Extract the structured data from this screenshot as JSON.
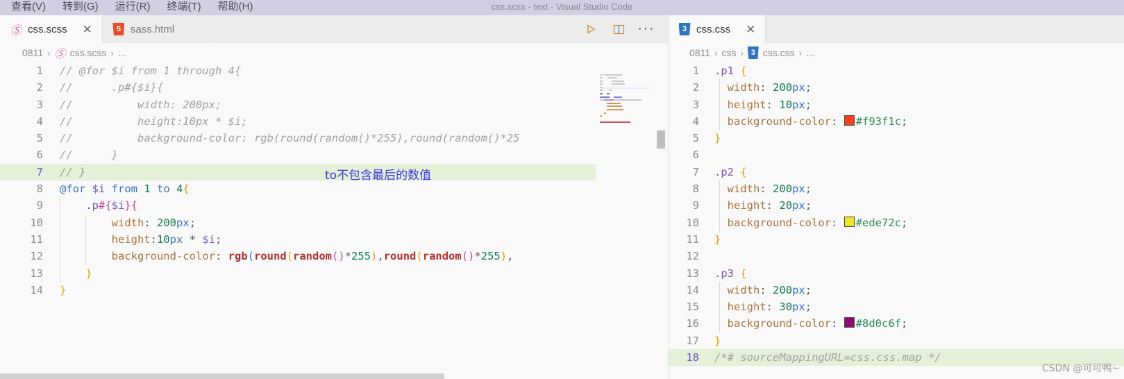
{
  "window": {
    "title": "css.scss - text - Visual Studio Code",
    "menus": [
      "查看(V)",
      "转到(G)",
      "运行(R)",
      "终端(T)",
      "帮助(H)"
    ]
  },
  "left_group": {
    "tabs": [
      {
        "label": "css.scss",
        "icon": "sass-icon",
        "close": "✕",
        "active": true
      },
      {
        "label": "sass.html",
        "icon": "html5-icon",
        "close": "✕",
        "active": false
      }
    ],
    "actions": [
      {
        "name": "run-icon",
        "glyph": "▷"
      },
      {
        "name": "split-editor-icon",
        "glyph": "▣"
      },
      {
        "name": "more-actions-icon",
        "glyph": "···"
      }
    ],
    "breadcrumb": [
      "0811",
      "css.scss",
      "..."
    ],
    "breadcrumb_icon": "sass-icon",
    "annotation": "to不包含最后的数值",
    "lines": [
      {
        "n": "1",
        "current": false
      },
      {
        "n": "2",
        "current": false
      },
      {
        "n": "3",
        "current": false
      },
      {
        "n": "4",
        "current": false
      },
      {
        "n": "5",
        "current": false
      },
      {
        "n": "6",
        "current": false
      },
      {
        "n": "7",
        "current": true
      },
      {
        "n": "8",
        "current": false
      },
      {
        "n": "9",
        "current": false
      },
      {
        "n": "10",
        "current": false
      },
      {
        "n": "11",
        "current": false
      },
      {
        "n": "12",
        "current": false
      },
      {
        "n": "13",
        "current": false
      },
      {
        "n": "14",
        "current": false
      }
    ],
    "code_text": [
      "// @for $i from 1 through 4{",
      "//      .p#{$i}{",
      "//          width: 200px;",
      "//          height:10px * $i;",
      "//          background-color: rgb(round(random()*255),round(random()*25",
      "//      }",
      "// }",
      "@for $i from 1 to 4{",
      "    .p#{$i}{",
      "        width: 200px;",
      "        height:10px * $i;",
      "        background-color: rgb(round(random()*255),round(random()*255),",
      "    }",
      "}"
    ]
  },
  "right_group": {
    "tabs": [
      {
        "label": "css.css",
        "icon": "css3-icon",
        "close": "✕",
        "active": true
      }
    ],
    "breadcrumb": [
      "0811",
      "css",
      "css.css",
      "..."
    ],
    "breadcrumb_icon": "css3-icon",
    "watermark": "CSDN @可可鸭~",
    "lines": [
      {
        "n": "1",
        "current": false
      },
      {
        "n": "2",
        "current": false
      },
      {
        "n": "3",
        "current": false
      },
      {
        "n": "4",
        "current": false
      },
      {
        "n": "5",
        "current": false
      },
      {
        "n": "6",
        "current": false
      },
      {
        "n": "7",
        "current": false
      },
      {
        "n": "8",
        "current": false
      },
      {
        "n": "9",
        "current": false
      },
      {
        "n": "10",
        "current": false
      },
      {
        "n": "11",
        "current": false
      },
      {
        "n": "12",
        "current": false
      },
      {
        "n": "13",
        "current": false
      },
      {
        "n": "14",
        "current": false
      },
      {
        "n": "15",
        "current": false
      },
      {
        "n": "16",
        "current": false
      },
      {
        "n": "17",
        "current": false
      },
      {
        "n": "18",
        "current": true
      }
    ],
    "code_text": [
      ".p1 {",
      "  width: 200px;",
      "  height: 10px;",
      "  background-color: #f93f1c;",
      "}",
      "",
      ".p2 {",
      "  width: 200px;",
      "  height: 20px;",
      "  background-color: #ede72c;",
      "}",
      "",
      ".p3 {",
      "  width: 200px;",
      "  height: 30px;",
      "  background-color: #8d0c6f;",
      "}",
      "/*# sourceMappingURL=css.css.map */"
    ],
    "swatches": {
      "p1": "#f93f1c",
      "p2": "#ede72c",
      "p3": "#8d0c6f"
    }
  },
  "theme": {
    "titlebar_bg": "#d3cfe2",
    "editor_bg": "#f9f9f9",
    "tabbar_bg": "#ececec",
    "current_line_bg": "#e4f0d8",
    "annotation_color": "#3b3be0",
    "ruler_mark": "#6b57c4"
  }
}
